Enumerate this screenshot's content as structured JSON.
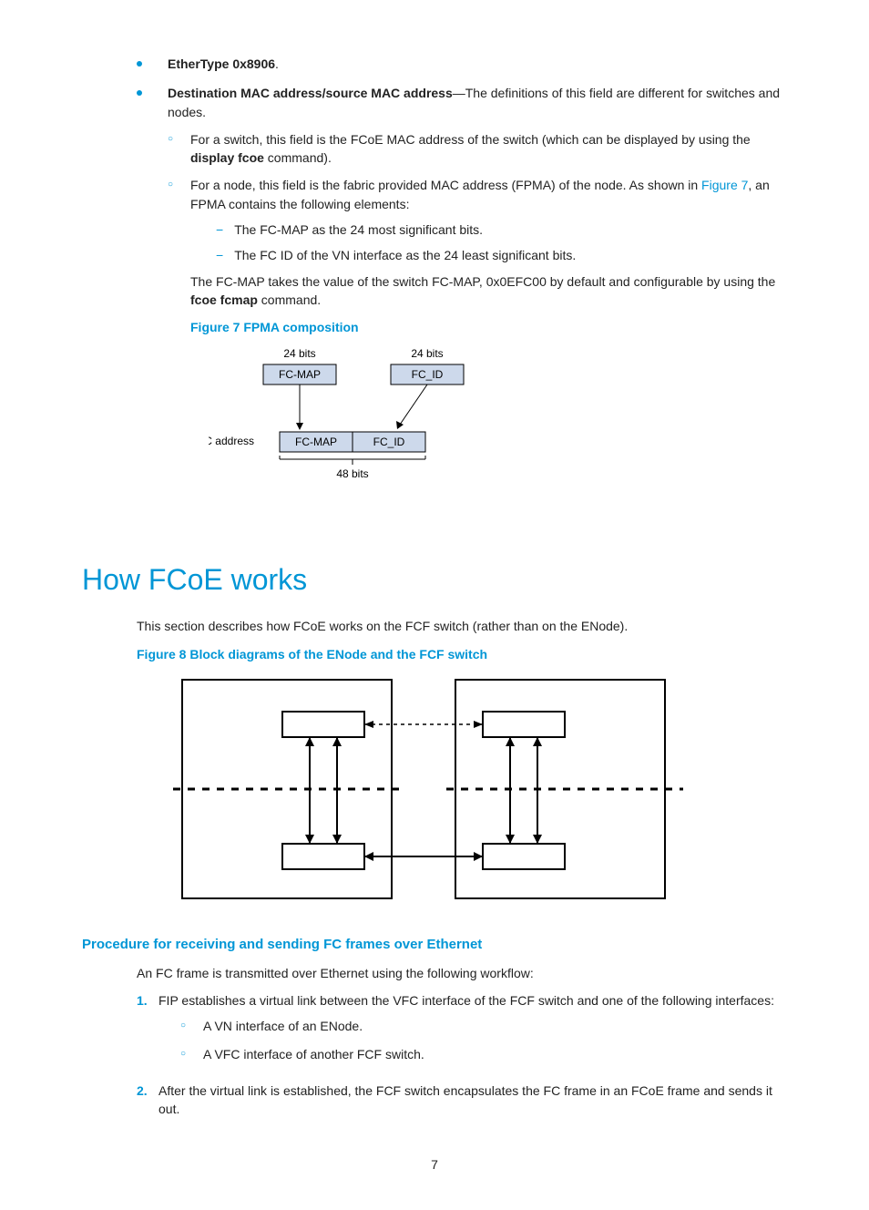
{
  "top_bullets": [
    {
      "label": "EtherType 0x8906",
      "suffix": "."
    },
    {
      "label": "Destination MAC address/source MAC address",
      "suffix": "—The definitions of this field are different for switches and nodes."
    }
  ],
  "circ_items": [
    {
      "prefix": "For a switch, this field is the FCoE MAC address of the switch (which can be displayed by using the ",
      "bold": "display fcoe",
      "suffix": " command)."
    },
    {
      "prefix": "For a node, this field is the fabric provided MAC address (FPMA) of the node. As shown in ",
      "link": "Figure 7",
      "suffix": ", an FPMA contains the following elements:"
    }
  ],
  "dash_items": [
    "The FC-MAP as the 24 most significant bits.",
    "The FC ID of the VN interface as the 24 least significant bits."
  ],
  "fcmap_para": {
    "prefix": "The FC-MAP takes the value of the switch FC-MAP, 0x0EFC00 by default and configurable by using the ",
    "bold": "fcoe fcmap",
    "suffix": " command."
  },
  "figure7": {
    "caption": "Figure 7 FPMA composition",
    "bits_top": "24 bits",
    "fcmap": "FC-MAP",
    "fcid": "FC_ID",
    "mac_label": "MAC address",
    "bits_bottom": "48 bits"
  },
  "section": {
    "title": "How FCoE works",
    "intro": "This section describes how FCoE works on the FCF switch (rather than on the ENode)."
  },
  "figure8": {
    "caption": "Figure 8 Block diagrams of the ENode and the FCF switch"
  },
  "subhead": "Procedure for receiving and sending FC frames over Ethernet",
  "proc_intro": "An FC frame is transmitted over Ethernet using the following workflow:",
  "num_items": [
    {
      "n": "1.",
      "text": "FIP establishes a virtual link between the VFC interface of the FCF switch and one of the following interfaces:",
      "sub": [
        "A VN interface of an ENode.",
        "A VFC interface of another FCF switch."
      ]
    },
    {
      "n": "2.",
      "text": "After the virtual link is established, the FCF switch encapsulates the FC frame in an FCoE frame and sends it out."
    }
  ],
  "page_number": "7"
}
